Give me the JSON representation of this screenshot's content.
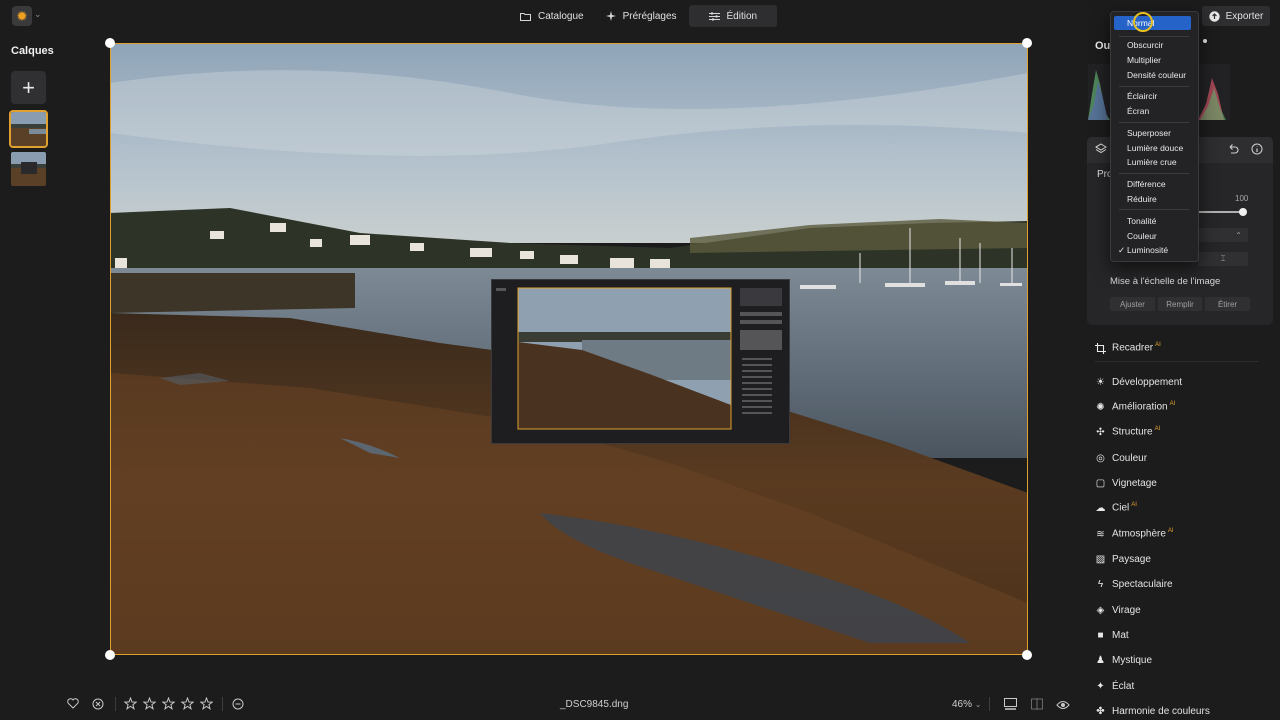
{
  "topbar": {
    "tabs": [
      {
        "label": "Catalogue",
        "icon": "folder-icon"
      },
      {
        "label": "Préréglages",
        "icon": "sparkle-icon"
      },
      {
        "label": "Édition",
        "icon": "sliders-icon",
        "active": true
      }
    ],
    "export_label": "Exporter"
  },
  "layers": {
    "title": "Calques",
    "add_label": "+"
  },
  "right_panel": {
    "section_title": "Out",
    "layer_card": {
      "title_fragment": "Pro",
      "opacity_value": "100",
      "scale_label": "Mise à l'échelle de l'image",
      "scale_buttons": [
        "Ajuster",
        "Remplir",
        "Étirer"
      ]
    },
    "tools": [
      {
        "label": "Recadrer",
        "icon": "crop-icon",
        "ai": true
      },
      {
        "label": "Développement",
        "icon": "sun-icon",
        "ai": false
      },
      {
        "label": "Amélioration",
        "icon": "sparkle-icon",
        "ai": true
      },
      {
        "label": "Structure",
        "icon": "structure-icon",
        "ai": true
      },
      {
        "label": "Couleur",
        "icon": "color-icon",
        "ai": false
      },
      {
        "label": "Vignetage",
        "icon": "vignette-icon",
        "ai": false
      },
      {
        "label": "Ciel",
        "icon": "cloud-icon",
        "ai": true
      },
      {
        "label": "Atmosphère",
        "icon": "atmosphere-icon",
        "ai": true
      },
      {
        "label": "Paysage",
        "icon": "landscape-icon",
        "ai": false
      },
      {
        "label": "Spectaculaire",
        "icon": "bolt-icon",
        "ai": false
      },
      {
        "label": "Virage",
        "icon": "toning-icon",
        "ai": false
      },
      {
        "label": "Mat",
        "icon": "matte-icon",
        "ai": false
      },
      {
        "label": "Mystique",
        "icon": "mystic-icon",
        "ai": false
      },
      {
        "label": "Éclat",
        "icon": "glow-icon",
        "ai": false
      },
      {
        "label": "Harmonie de couleurs",
        "icon": "harmony-icon",
        "ai": false
      }
    ]
  },
  "blend_menu": {
    "highlighted": "Normal",
    "checked": "Luminosité",
    "groups": [
      [
        "Normal"
      ],
      [
        "Obscurcir",
        "Multiplier",
        "Densité couleur"
      ],
      [
        "Éclaircir",
        "Écran"
      ],
      [
        "Superposer",
        "Lumière douce",
        "Lumière crue"
      ],
      [
        "Différence",
        "Réduire"
      ],
      [
        "Tonalité",
        "Couleur",
        "Luminosité"
      ]
    ]
  },
  "bottom": {
    "filename": "_DSC9845.dng",
    "zoom": "46%",
    "rating_stars": 5,
    "rating_value": 0
  },
  "colors": {
    "accent": "#e0a030",
    "highlight": "#2563c9",
    "background": "#1c1c1d"
  }
}
